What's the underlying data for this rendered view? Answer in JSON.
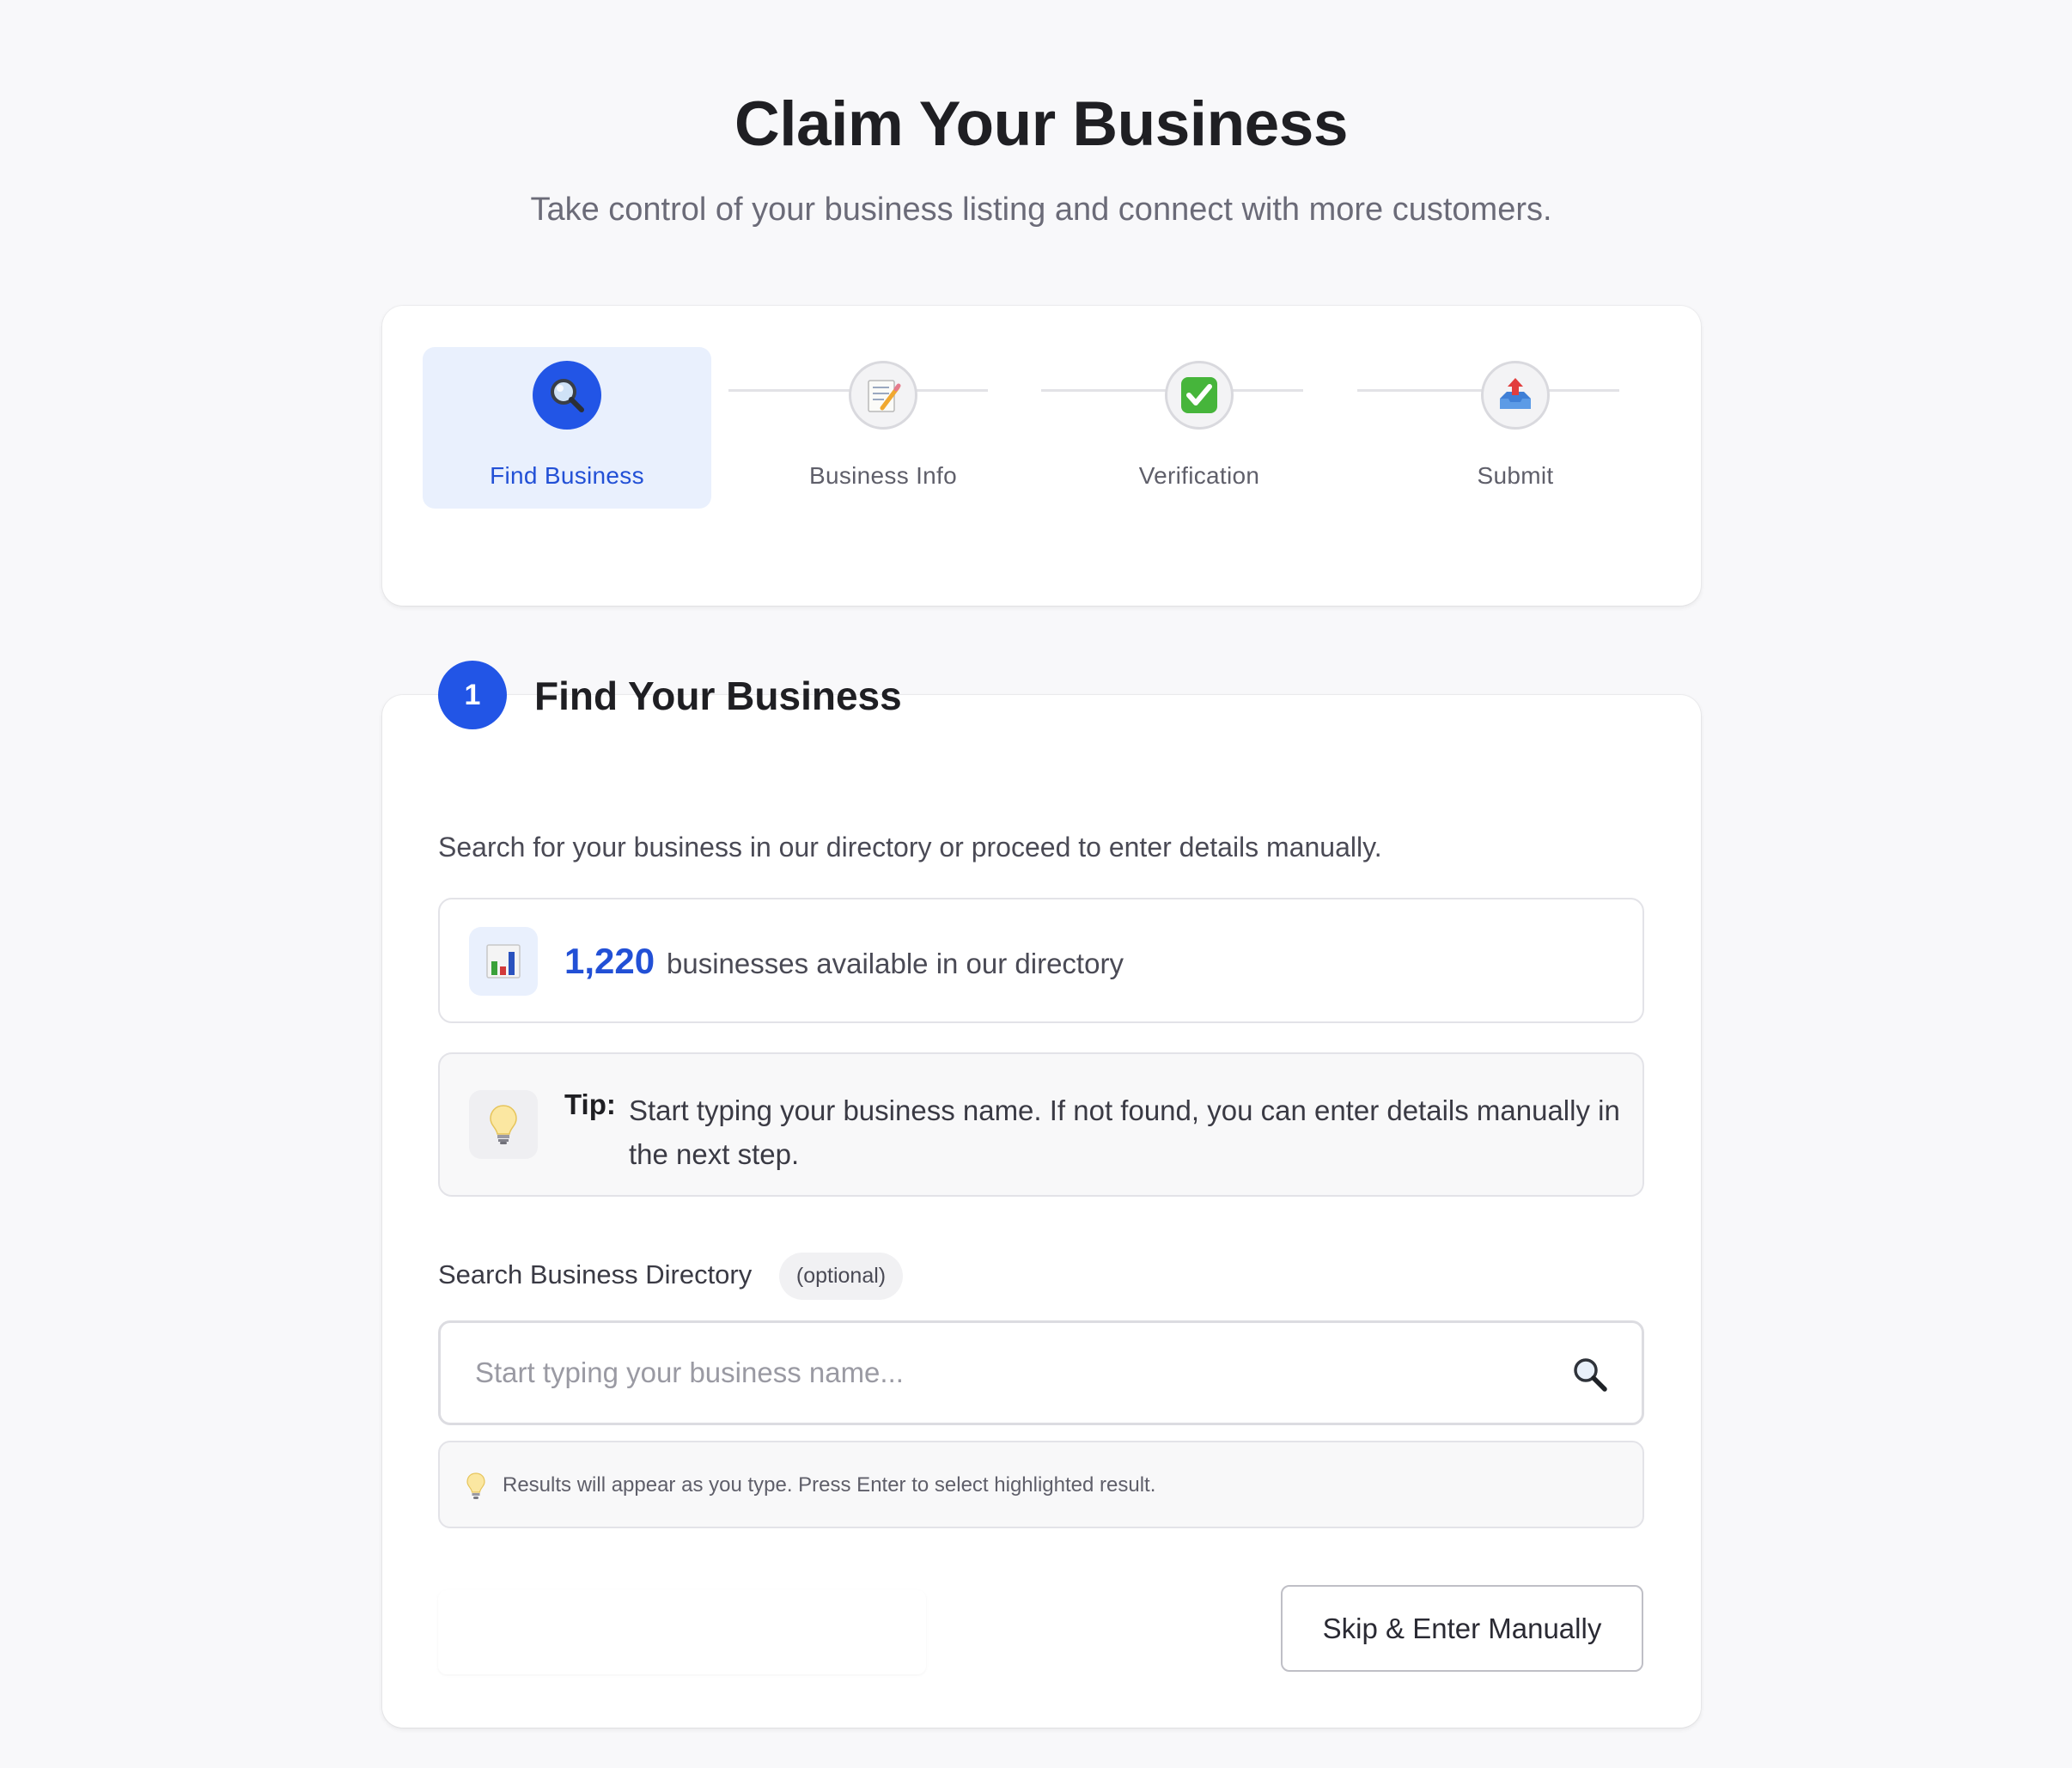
{
  "header": {
    "title": "Claim Your Business",
    "subtitle": "Take control of your business listing and connect with more customers."
  },
  "stepper": {
    "steps": [
      {
        "label": "Find Business",
        "icon": "magnifier-icon",
        "active": true
      },
      {
        "label": "Business Info",
        "icon": "memo-icon",
        "active": false
      },
      {
        "label": "Verification",
        "icon": "check-mark-icon",
        "active": false
      },
      {
        "label": "Submit",
        "icon": "outbox-tray-icon",
        "active": false
      }
    ]
  },
  "section": {
    "number": "1",
    "title": "Find Your Business",
    "description": "Search for your business in our directory or proceed to enter details manually."
  },
  "stats": {
    "icon": "bar-chart-icon",
    "count": "1,220",
    "text": "businesses available in our directory"
  },
  "tip": {
    "icon": "lightbulb-icon",
    "label": "Tip:",
    "text": "Start typing your business name. If not found, you can enter details manually in the next step."
  },
  "search": {
    "label": "Search Business Directory",
    "badge": "(optional)",
    "placeholder": "Start typing your business name...",
    "value": "",
    "icon": "search-icon",
    "hint": "Results will appear as you type. Press Enter to select highlighted result."
  },
  "actions": {
    "skip_label": "Skip & Enter Manually"
  },
  "colors": {
    "accent": "#2255e6",
    "accent_text": "#2250d6",
    "active_step_bg": "#e9f0fd",
    "background": "#f8f8fa"
  }
}
